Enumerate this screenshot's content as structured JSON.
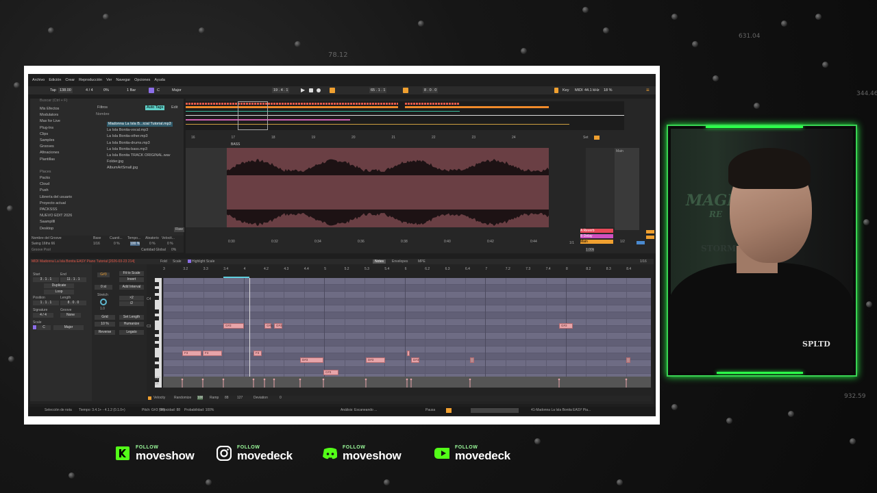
{
  "background": {
    "numbers": [
      "78.12",
      "631.04",
      "344.46",
      "932.59"
    ]
  },
  "menu": [
    "Archivo",
    "Edición",
    "Crear",
    "Reproducción",
    "Ver",
    "Navegar",
    "Opciones",
    "Ayuda"
  ],
  "transport": {
    "tap": "Tap",
    "tempo": "138.00",
    "signature": "4 / 4",
    "percent": "0%",
    "bar": "1 Bar",
    "key": "C",
    "scale": "Major",
    "position": "19 . 4 . 1",
    "loop_start": "65 . 1 . 1",
    "loop_len": "8 . 0 . 0",
    "key_label": "Key",
    "midi_label": "MIDI",
    "sample_rate": "44.1 kHz",
    "cpu": "18 %"
  },
  "browser": {
    "search_placeholder": "Buscar (Ctrl + F)",
    "categories": [
      "Mis Efectos",
      "Modulators",
      "Max for Live",
      "Plug-Ins",
      "Clips",
      "Samples",
      "Grooves",
      "Afinaciones",
      "Plantillas"
    ],
    "places_header": "Places",
    "places": [
      "Packs",
      "Cloud",
      "Push",
      "Librería del usuario",
      "Proyecto actual",
      "PACKSSS",
      "NUEVO EDIT 2026",
      "Saampllll",
      "Desktop"
    ],
    "filter_label": "Filtros",
    "auto_tags": "Auto Tags",
    "edit": "Edit",
    "name_header": "Nombre",
    "files": [
      "Madonna La Isla B...icial Tutorial.mp3",
      "La Isla Bonita-vocal.mp3",
      "La Isla Bonita-other.mp3",
      "La Isla Bonita-drums.mp3",
      "La Isla Bonita-bass.mp3",
      "La Isla Bonita TRACK ORIGINAL.wav",
      "Folder.jpg",
      "AlbumArtSmall.jpg"
    ],
    "raw": "Raw"
  },
  "groove": {
    "header": "Nombre del Groove",
    "base": "Base",
    "cuanti": "Cuanti...",
    "tempo": "Tempo...",
    "aleatorio": "Aleatorio",
    "veloci": "Velocit...",
    "row_name": "Swing 16ths 66",
    "row_base": "1/16",
    "row_q": "0 %",
    "row_t": "100 %",
    "row_a": "0 %",
    "row_v": "0 %",
    "pool": "Groove Pool",
    "global": "Cantidad Global",
    "global_val": "0%"
  },
  "arrangement": {
    "ruler": [
      "16",
      "17",
      "18",
      "19",
      "20",
      "21",
      "22",
      "23",
      "24"
    ],
    "times": [
      "0:30",
      "0:32",
      "0:34",
      "0:36",
      "0:38",
      "0:40",
      "0:42",
      "0:44"
    ],
    "track_name": "BASS",
    "set_label": "Set",
    "main": "Main",
    "sends": [
      "A Reverb",
      "B Delay",
      "Main"
    ],
    "ratio": "1/1",
    "half": "1/2",
    "vol": "1.00k"
  },
  "clip_editor": {
    "title": "MIDI Madonna La Isla Bonita EASY Piano Tutorial [2026-03-23 214]",
    "fold": "Fold",
    "scale": "Scale",
    "highlight": "Highlight Scale",
    "tabs": [
      "Notes",
      "Envelopes",
      "MPE"
    ],
    "grid": "1/16",
    "start_label": "Start",
    "end_label": "End",
    "start_val": "3 . 1 . 1",
    "end_val": "11 . 1 . 1",
    "duplicate": "Duplicate",
    "loop": "Loop",
    "position_label": "Position",
    "length_label": "Length",
    "position_val": "1 . 1 . 1",
    "length_val": "8 . 0 . 0",
    "signature_label": "Signature",
    "groove_label": "Groove",
    "sig_val": "4 / 4",
    "groove_val": "None",
    "scale_label": "Scale",
    "scale_key": "C",
    "scale_mode": "Major",
    "pitch": "G#3",
    "fit": "Fit to Scale",
    "invert": "Invert",
    "st": "0 st",
    "add_interval": "Add Interval",
    "stretch": "Stretch",
    "x2": "×2",
    "div2": "/2",
    "stretch_val": "1.0",
    "grid_label": "Grid",
    "set_length": "Set Length",
    "pct": "10 %",
    "humanize": "Humanize",
    "reverse": "Reverse",
    "legato": "Legato",
    "key_c4": "C4",
    "key_c3": "C3",
    "key_g3": "G#3",
    "notes": [
      {
        "label": "G#3",
        "dim": false
      },
      {
        "label": "G#3",
        "dim": false
      },
      {
        "label": "G#3",
        "dim": false
      },
      {
        "label": "G#3",
        "dim": false
      },
      {
        "label": "F3",
        "dim": false
      },
      {
        "label": "F3",
        "dim": false
      },
      {
        "label": "F3",
        "dim": false
      },
      {
        "label": "D#3",
        "dim": false
      },
      {
        "label": "D#3",
        "dim": false
      },
      {
        "label": "D#3",
        "dim": false
      },
      {
        "label": "",
        "dim": false
      },
      {
        "label": "",
        "dim": true
      },
      {
        "label": "",
        "dim": true
      },
      {
        "label": "C#3",
        "dim": false
      }
    ],
    "ruler": [
      "3",
      "3.2",
      "3.3",
      "3.4",
      "4",
      "4.2",
      "4.3",
      "4.4",
      "5",
      "5.2",
      "5.3",
      "5.4",
      "6",
      "6.2",
      "6.3",
      "6.4",
      "7",
      "7.2",
      "7.3",
      "7.4",
      "8",
      "8.2",
      "8.3",
      "8.4"
    ],
    "velocity_label": "Velocity",
    "randomize": "Randomize",
    "rand_val": "100",
    "ramp": "Ramp",
    "ramp_a": "88",
    "ramp_b": "127",
    "deviation": "Deviation",
    "dev_val": "0",
    "vel_127": "127",
    "vel_64": "64"
  },
  "status": {
    "selection": "Selección de nota",
    "time": "Tiempo: 3.4.1+ - 4.1.2 (0.1.0+)",
    "pitch": "Pitch: G#3 (68)",
    "velocity": "Velocidad: 88",
    "probability": "Probabilidad: 100%",
    "analysis": "Análisis: Escaneando ...",
    "pause": "Pausa",
    "track": "41-Madonna La Isla Bonita EASY Pia..."
  },
  "webcam": {
    "logo_text": "MAGMA",
    "subtext": "RE",
    "caption": "STORM",
    "shirt": "SPLTD"
  },
  "socials": [
    {
      "icon": "kick-icon",
      "follow": "FOLLOW",
      "handle": "moveshow",
      "color": "#53fc18"
    },
    {
      "icon": "instagram-icon",
      "follow": "FOLLOW",
      "handle": "movedeck",
      "color": "#ffffff"
    },
    {
      "icon": "discord-icon",
      "follow": "FOLLOW",
      "handle": "moveshow",
      "color": "#53fc18"
    },
    {
      "icon": "youtube-icon",
      "follow": "FOLLOW",
      "handle": "movedeck",
      "color": "#53fc18"
    }
  ],
  "colors": {
    "accent_green": "#39d353",
    "clip": "#6a3f44",
    "note": "#e7a4a9",
    "ableton_orange": "#f0a030"
  }
}
